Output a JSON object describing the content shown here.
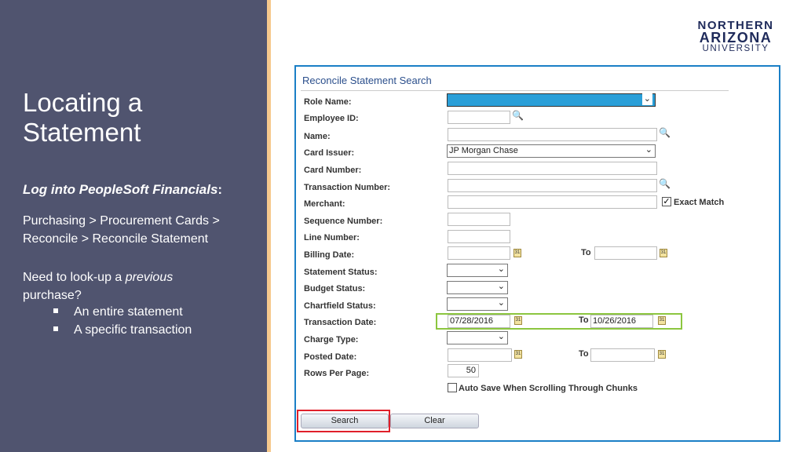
{
  "slide": {
    "title_line1": "Locating a",
    "title_line2": "Statement",
    "lead": "Log into PeopleSoft Financials",
    "lead_colon": ":",
    "path_line1": "Purchasing > Procurement Cards >",
    "path_line2": "Reconcile > Reconcile Statement",
    "need_pre": "Need to look-up a ",
    "need_em": "previous",
    "need_post": "purchase?",
    "bullets": [
      "An entire statement",
      "A specific transaction"
    ]
  },
  "logo": {
    "line1": "NORTHERN",
    "line2": "ARIZONA",
    "line3": "UNIVERSITY"
  },
  "form": {
    "title": "Reconcile Statement Search",
    "labels": {
      "role": "Role Name:",
      "emp": "Employee ID:",
      "name": "Name:",
      "issuer": "Card Issuer:",
      "cardnum": "Card Number:",
      "transnum": "Transaction Number:",
      "merchant": "Merchant:",
      "seq": "Sequence Number:",
      "line": "Line Number:",
      "billing": "Billing Date:",
      "stmt": "Statement Status:",
      "budget": "Budget Status:",
      "chart": "Chartfield Status:",
      "transdate": "Transaction Date:",
      "charge": "Charge Type:",
      "posted": "Posted Date:",
      "rows": "Rows Per Page:"
    },
    "to": "To",
    "card_issuer": "JP Morgan Chase",
    "exact_match": "Exact Match",
    "exact_match_checked": true,
    "trans_date_from": "07/28/2016",
    "trans_date_to": "10/26/2016",
    "rows_per_page": "50",
    "auto_save": "Auto Save When Scrolling Through Chunks",
    "auto_save_checked": false,
    "search": "Search",
    "clear": "Clear"
  },
  "colors": {
    "panel": "#50546f",
    "accent_stripe": "#f6c98d",
    "frame": "#1a7fc6",
    "role_highlight": "#2a9fd8",
    "date_highlight": "#8cc63f",
    "search_highlight": "#e0202a"
  }
}
